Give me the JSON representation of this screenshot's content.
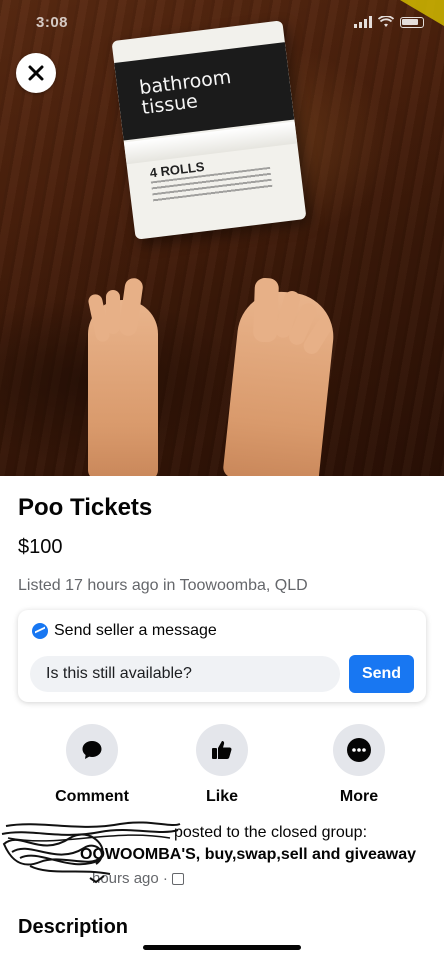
{
  "status_bar": {
    "time": "3:08"
  },
  "photo": {
    "product_text": {
      "brand": "bathroom tissue",
      "rolls": "4 ROLLS"
    }
  },
  "listing": {
    "title": "Poo Tickets",
    "price": "$100",
    "listed": "Listed 17 hours ago in Toowoomba, QLD"
  },
  "message_card": {
    "header": "Send seller a message",
    "input_value": "Is this still available?",
    "send_label": "Send"
  },
  "actions": [
    {
      "label": "Comment",
      "icon": "comment-icon"
    },
    {
      "label": "Like",
      "icon": "thumbs-up-icon"
    },
    {
      "label": "More",
      "icon": "more-icon"
    }
  ],
  "posted": {
    "line1": "posted to the closed group:",
    "group_name": "OOWOOMBA'S, buy,swap,sell and giveaway",
    "time": "hours ago ·"
  },
  "description": {
    "heading": "Description"
  },
  "colors": {
    "accent": "#1877f2",
    "secondary_text": "#65676b",
    "action_bg": "#e4e6eb"
  }
}
